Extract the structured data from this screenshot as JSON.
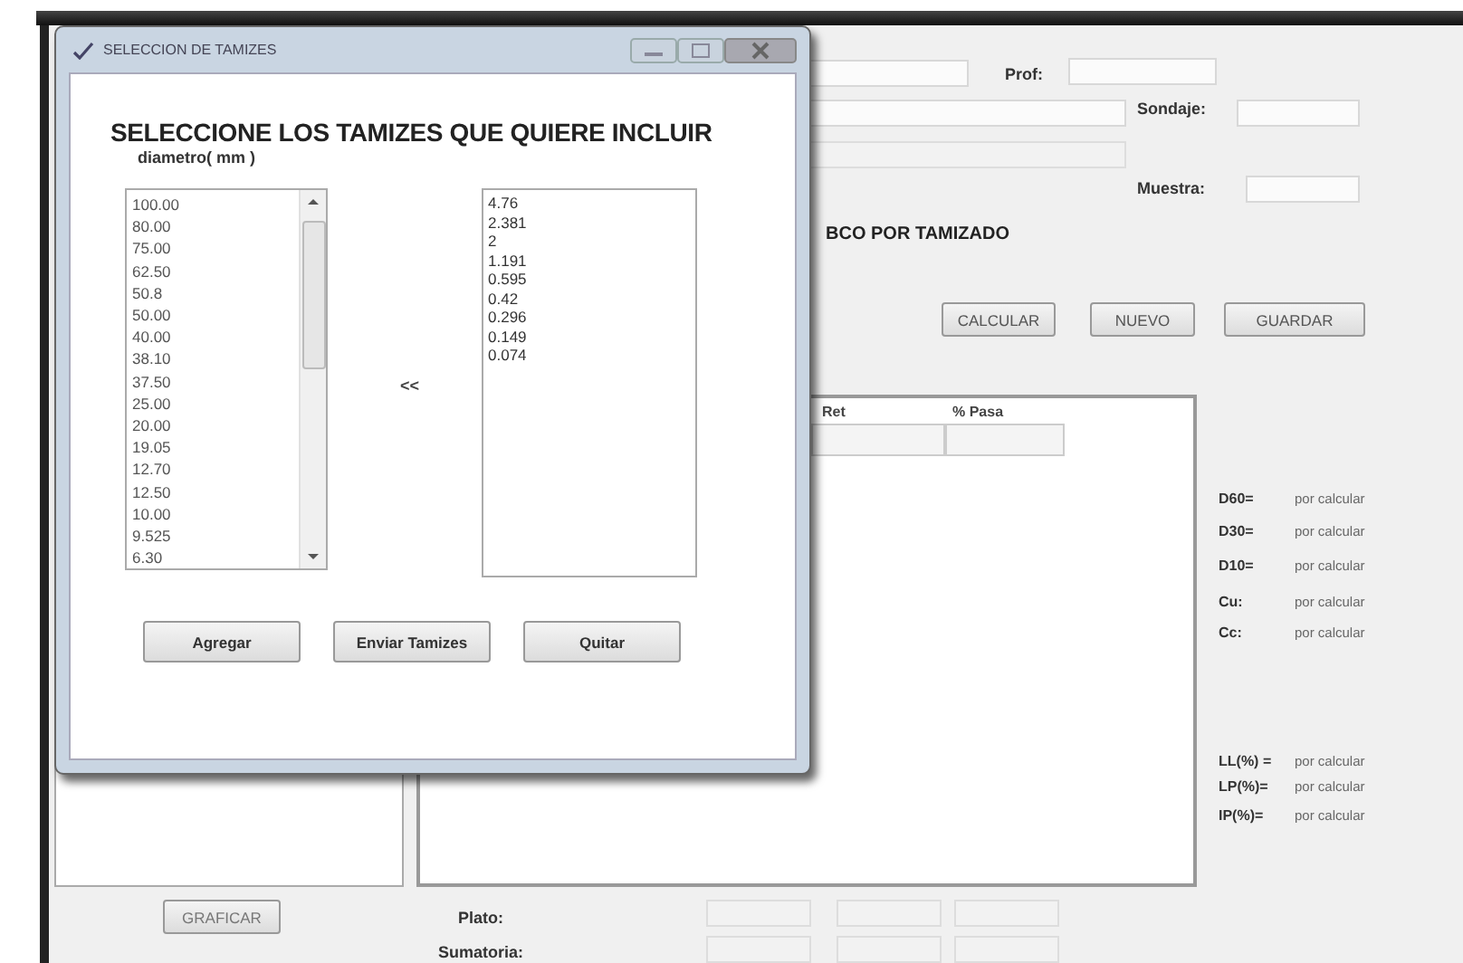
{
  "main_form": {
    "labels": {
      "prof": "Prof:",
      "sondaje": "Sondaje:",
      "muestra": "Muestra:"
    },
    "section_title": "BCO POR TAMIZADO",
    "buttons": [
      "CALCULAR",
      "NUEVO",
      "GUARDAR"
    ],
    "table": {
      "columns": [
        "Ret",
        "% Pasa"
      ]
    },
    "results": [
      {
        "label": "D60=",
        "value": "por calcular"
      },
      {
        "label": "D30=",
        "value": "por calcular"
      },
      {
        "label": "D10=",
        "value": "por calcular"
      },
      {
        "label": "Cu:",
        "value": "por calcular"
      },
      {
        "label": "Cc:",
        "value": "por calcular"
      }
    ],
    "limits": [
      {
        "label": "LL(%) =",
        "value": "por calcular"
      },
      {
        "label": "LP(%)=",
        "value": "por calcular"
      },
      {
        "label": "IP(%)=",
        "value": "por calcular"
      }
    ],
    "graph_button": "GRAFICAR",
    "totals": [
      "Plato:",
      "Sumatoria:"
    ]
  },
  "dialog": {
    "title": "SELECCION DE TAMIZES",
    "heading": "SELECCIONE LOS TAMIZES QUE QUIERE INCLUIR",
    "subheading": "diametro( mm )",
    "available": [
      "100.00",
      "80.00",
      "75.00",
      "62.50",
      "50.8",
      "50.00",
      "40.00",
      "38.10",
      "37.50",
      "25.00",
      "20.00",
      "19.05",
      "12.70",
      "12.50",
      "10.00",
      "9.525",
      "6.30"
    ],
    "selected_sieves": [
      "4.76",
      "2.381",
      "2",
      "1.191",
      "0.595",
      "0.42",
      "0.296",
      "0.149",
      "0.074"
    ],
    "move_label": "<<",
    "buttons": [
      "Agregar",
      "Enviar Tamizes",
      "Quitar"
    ]
  }
}
